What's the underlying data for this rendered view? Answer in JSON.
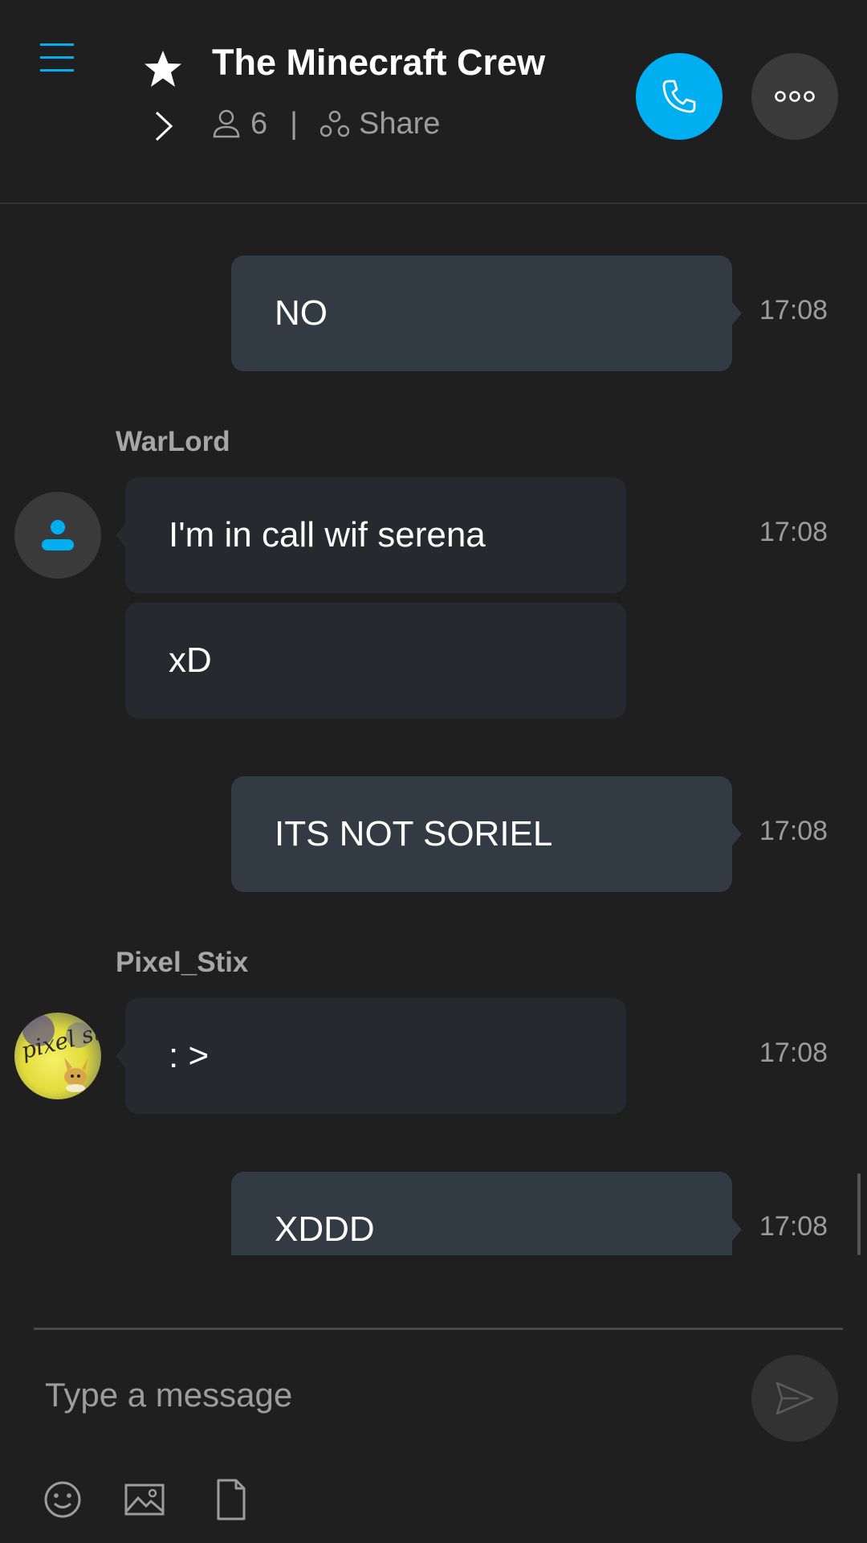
{
  "header": {
    "title": "The Minecraft Crew",
    "participants_count": "6",
    "separator": "|",
    "share_label": "Share"
  },
  "messages": [
    {
      "id": "m1",
      "direction": "outgoing",
      "text": "NO",
      "time": "17:08"
    },
    {
      "id": "m2",
      "direction": "incoming",
      "sender": "WarLord",
      "text": "I'm in call wif serena",
      "time": "17:08"
    },
    {
      "id": "m3",
      "direction": "incoming",
      "sender": "WarLord",
      "text": "xD"
    },
    {
      "id": "m4",
      "direction": "outgoing",
      "text": "ITS NOT SORIEL",
      "time": "17:08"
    },
    {
      "id": "m5",
      "direction": "incoming",
      "sender": "Pixel_Stix",
      "text": ": >",
      "time": "17:08"
    },
    {
      "id": "m6",
      "direction": "outgoing",
      "text": "XDDD",
      "time": "17:08"
    }
  ],
  "senders": {
    "warlord": "WarLord",
    "pixel_stix": "Pixel_Stix",
    "pixel_stix_avatar_text": "pixel stix"
  },
  "composer": {
    "placeholder": "Type a message"
  },
  "icons": {
    "menu": "hamburger-menu-icon",
    "favorite": "star-icon",
    "expand": "chevron-right-icon",
    "participants": "person-icon",
    "share": "share-icon",
    "call": "phone-icon",
    "more": "more-dots-icon",
    "send": "send-icon",
    "emoji": "emoji-icon",
    "image": "image-icon",
    "file": "file-icon"
  },
  "colors": {
    "accent": "#00aff0",
    "background": "#1f1f1f",
    "outgoing_bubble": "#323a44",
    "incoming_bubble": "#262a2e",
    "muted_text": "#9c9c9c"
  }
}
